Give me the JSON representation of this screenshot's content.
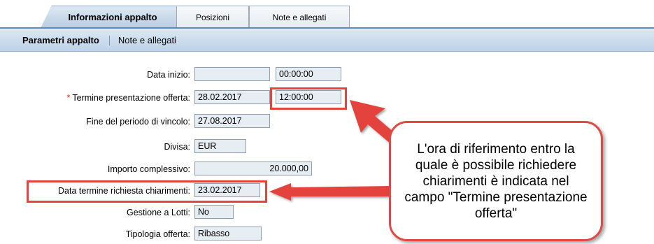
{
  "tabs": [
    {
      "label": "Informazioni appalto",
      "active": true
    },
    {
      "label": "Posizioni",
      "active": false
    },
    {
      "label": "Note e allegati",
      "active": false
    }
  ],
  "subtabs": [
    {
      "label": "Parametri appalto",
      "selected": true
    },
    {
      "label": "Note e allegati",
      "selected": false
    }
  ],
  "form": {
    "data_inizio": {
      "label": "Data inizio:",
      "date": "",
      "time": "00:00:00"
    },
    "termine_presentazione": {
      "label": "Termine presentazione offerta:",
      "required_mark": "*",
      "date": "28.02.2017",
      "time": "12:00:00"
    },
    "fine_periodo": {
      "label": "Fine del periodo di vincolo:",
      "date": "27.08.2017"
    },
    "divisa": {
      "label": "Divisa:",
      "value": "EUR"
    },
    "importo": {
      "label": "Importo complessivo:",
      "value": "20.000,00"
    },
    "data_termine_chiarimenti": {
      "label": "Data termine richiesta chiarimenti:",
      "date": "23.02.2017"
    },
    "gestione_lotti": {
      "label": "Gestione a Lotti:",
      "value": "No"
    },
    "tipologia_offerta": {
      "label": "Tipologia offerta:",
      "value": "Ribasso"
    }
  },
  "callout": {
    "text": "L'ora di riferimento entro la quale è possibile richiedere chiarimenti è indicata nel campo \"Termine presentazione offerta\""
  },
  "colors": {
    "highlight": "#e4433e",
    "tab_active": "#b9cde3",
    "subbar": "#bed2e7",
    "field_bg": "#e6edf3"
  }
}
